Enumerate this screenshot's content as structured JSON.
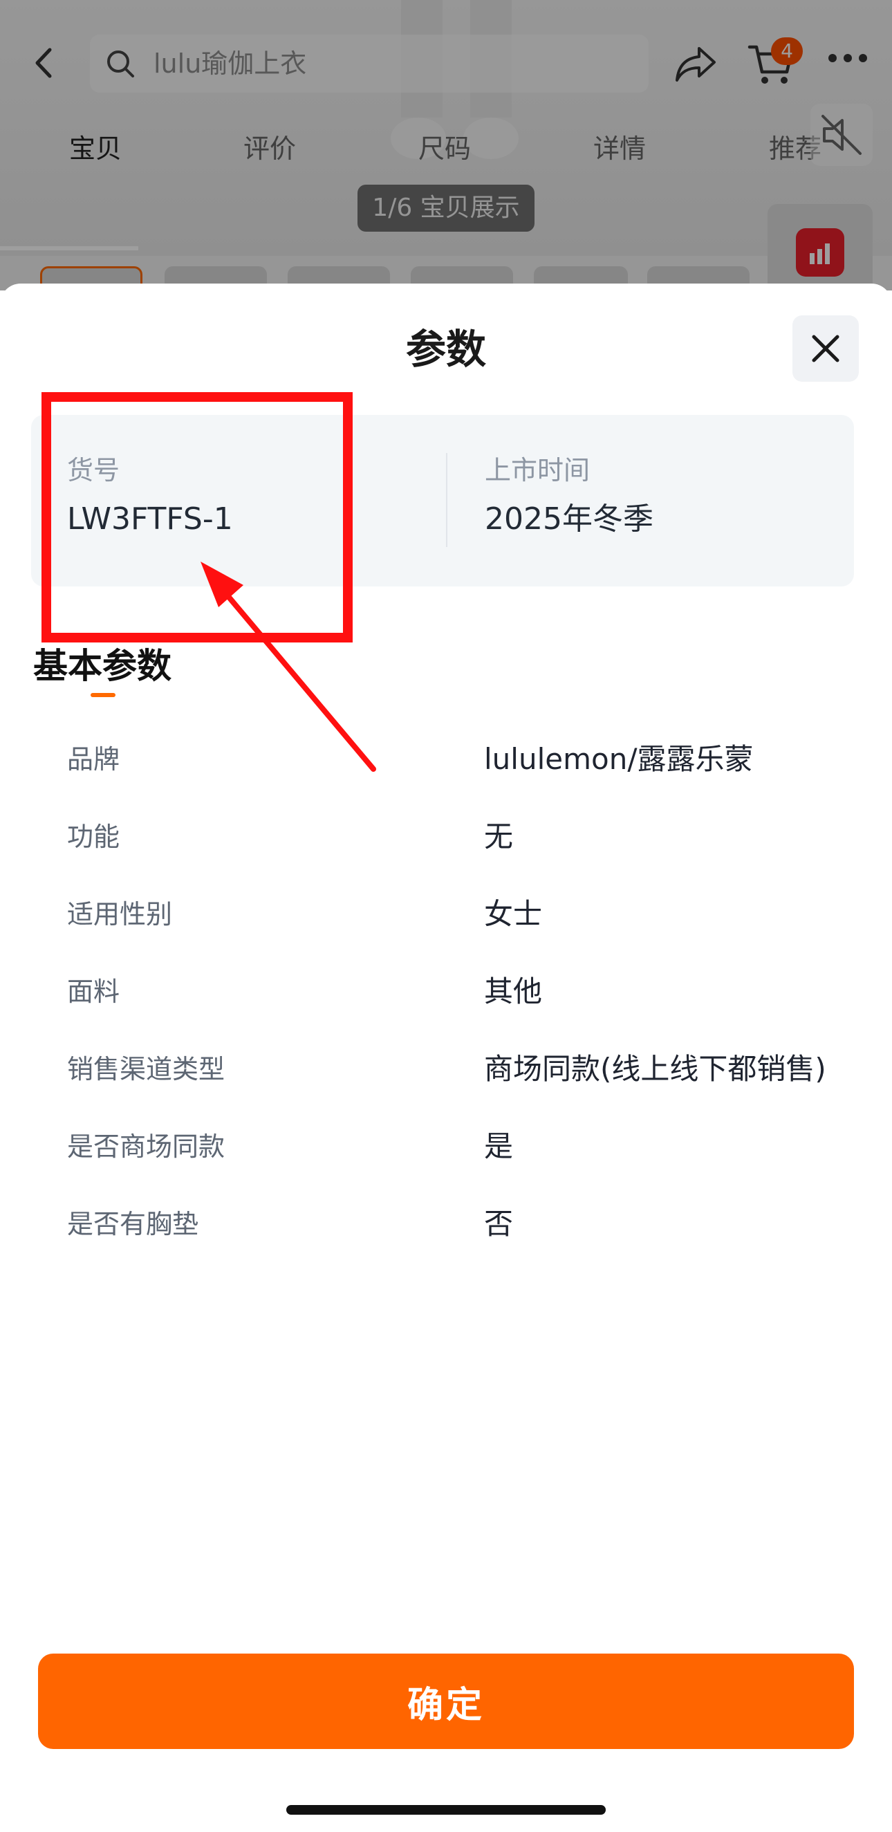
{
  "background": {
    "search": {
      "placeholder": "lulu瑜伽上衣"
    },
    "cart": {
      "badge_count": "4"
    },
    "tabs": [
      "宝贝",
      "评价",
      "尺码",
      "详情",
      "推荐"
    ],
    "gallery_counter": "1/6 宝贝展示",
    "icons": [
      "back-icon",
      "search-icon",
      "share-icon",
      "cart-icon",
      "more-icon",
      "mute-icon",
      "chart-icon"
    ]
  },
  "sheet": {
    "title": "参数",
    "close_icon": "close-icon",
    "highlight": [
      {
        "label": "货号",
        "value": "LW3FTFS-1"
      },
      {
        "label": "上市时间",
        "value": "2025年冬季"
      }
    ],
    "section_title": "基本参数",
    "params": [
      {
        "label": "品牌",
        "value": "lululemon/露露乐蒙"
      },
      {
        "label": "功能",
        "value": "无"
      },
      {
        "label": "适用性别",
        "value": "女士"
      },
      {
        "label": "面料",
        "value": "其他"
      },
      {
        "label": "销售渠道类型",
        "value": "商场同款(线上线下都销售)"
      },
      {
        "label": "是否商场同款",
        "value": "是"
      },
      {
        "label": "是否有胸垫",
        "value": "否"
      }
    ],
    "confirm_label": "确定"
  },
  "colors": {
    "accent": "#ff6500",
    "annotation": "#ff1010"
  }
}
